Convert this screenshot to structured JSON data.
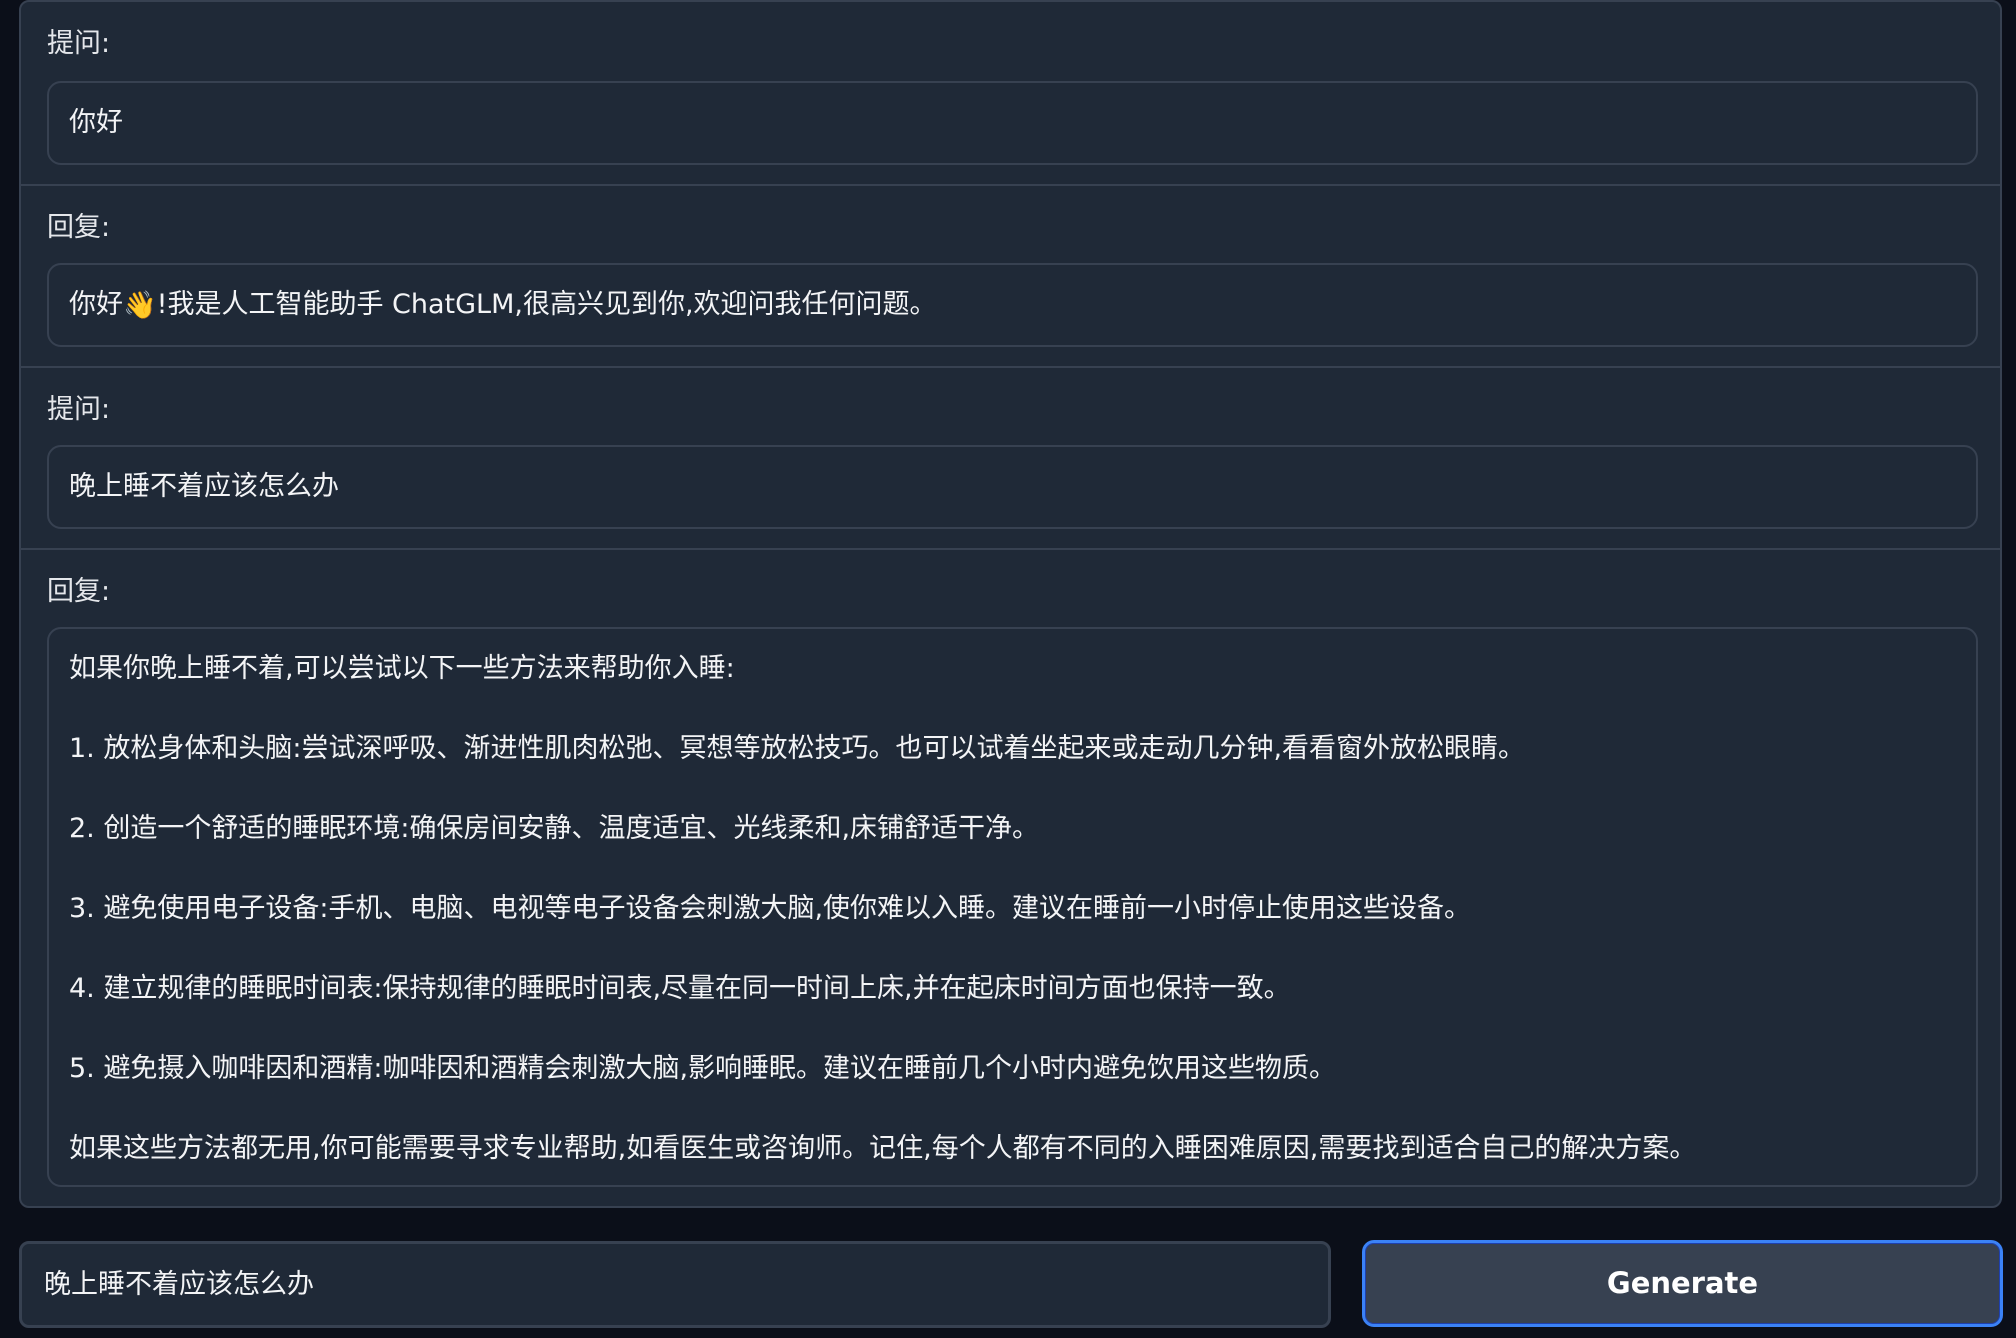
{
  "conversation": [
    {
      "role": "question",
      "label": "提问:",
      "text": "你好"
    },
    {
      "role": "answer",
      "label": "回复:",
      "text_before_emoji": "你好",
      "emoji_name": "waving-hand",
      "emoji": "👋",
      "text_after_emoji": "!我是人工智能助手 ChatGLM,很高兴见到你,欢迎问我任何问题。"
    },
    {
      "role": "question",
      "label": "提问:",
      "text": "晚上睡不着应该怎么办"
    },
    {
      "role": "answer",
      "label": "回复:",
      "paragraphs": [
        "如果你晚上睡不着,可以尝试以下一些方法来帮助你入睡:",
        "1. 放松身体和头脑:尝试深呼吸、渐进性肌肉松弛、冥想等放松技巧。也可以试着坐起来或走动几分钟,看看窗外放松眼睛。",
        "2. 创造一个舒适的睡眠环境:确保房间安静、温度适宜、光线柔和,床铺舒适干净。",
        "3. 避免使用电子设备:手机、电脑、电视等电子设备会刺激大脑,使你难以入睡。建议在睡前一小时停止使用这些设备。",
        "4. 建立规律的睡眠时间表:保持规律的睡眠时间表,尽量在同一时间上床,并在起床时间方面也保持一致。",
        "5. 避免摄入咖啡因和酒精:咖啡因和酒精会刺激大脑,影响睡眠。建议在睡前几个小时内避免饮用这些物质。",
        "如果这些方法都无用,你可能需要寻求专业帮助,如看医生或咨询师。记住,每个人都有不同的入睡困难原因,需要找到适合自己的解决方案。"
      ]
    }
  ],
  "input": {
    "value": "晚上睡不着应该怎么办"
  },
  "generate_button": {
    "label": "Generate"
  },
  "colors": {
    "page_background": "#0b0f19",
    "panel_background": "#1f2937",
    "border": "#374151",
    "button_focus_border": "#3b82f6",
    "text": "#e5e7eb"
  }
}
